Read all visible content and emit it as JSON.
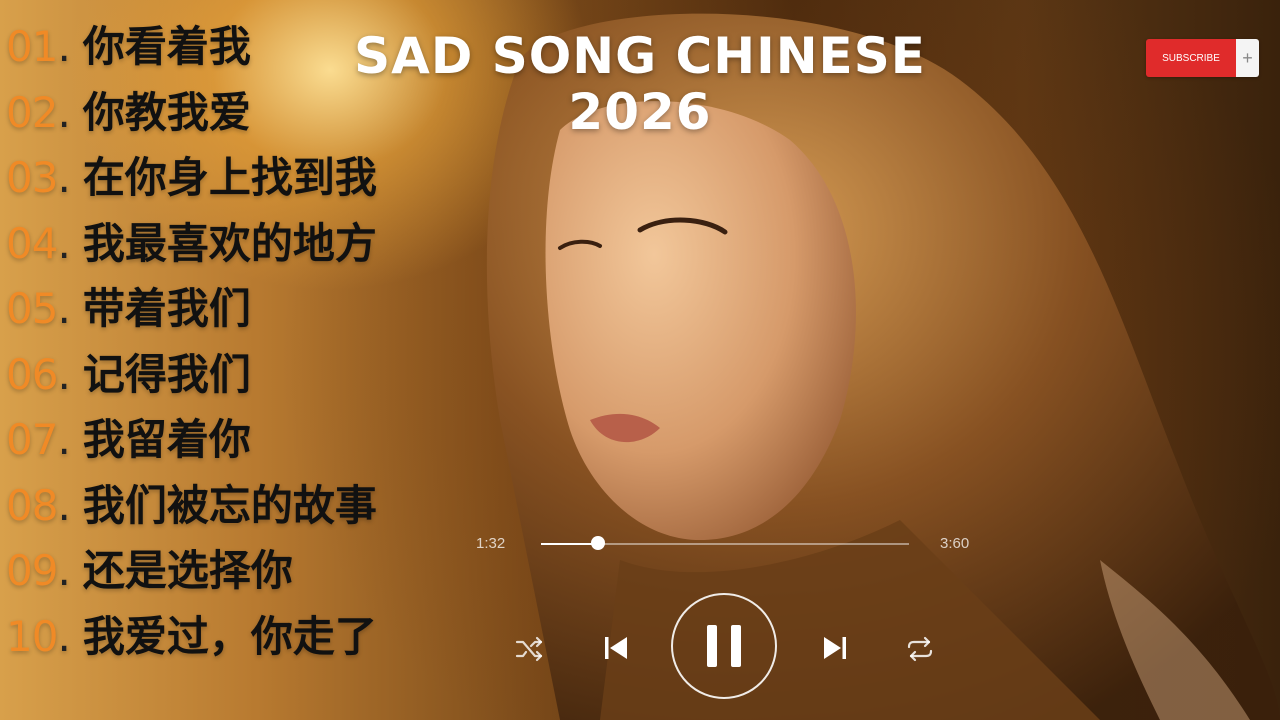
{
  "headline": {
    "line1": "SAD SONG CHINESE",
    "line2": "2026"
  },
  "subscribe": {
    "label": "SUBSCRIBE",
    "plus": "+"
  },
  "tracks": [
    {
      "num": "01",
      "title": "你看着我"
    },
    {
      "num": "02",
      "title": "你教我爱"
    },
    {
      "num": "03",
      "title": "在你身上找到我"
    },
    {
      "num": "04",
      "title": "我最喜欢的地方"
    },
    {
      "num": "05",
      "title": "带着我们"
    },
    {
      "num": "06",
      "title": "记得我们"
    },
    {
      "num": "07",
      "title": "我留着你"
    },
    {
      "num": "08",
      "title": "我们被忘的故事"
    },
    {
      "num": "09",
      "title": "还是选择你"
    },
    {
      "num": "10",
      "title": "我爱过，你走了"
    }
  ],
  "player": {
    "elapsed": "1:32",
    "duration": "3:60",
    "progress": 0.155,
    "icons": [
      "shuffle-icon",
      "previous-icon",
      "pause-icon",
      "next-icon",
      "repeat-icon"
    ]
  },
  "colors": {
    "number": "#f08a26",
    "title": "#111111",
    "subscribe": "#e02b2b"
  }
}
